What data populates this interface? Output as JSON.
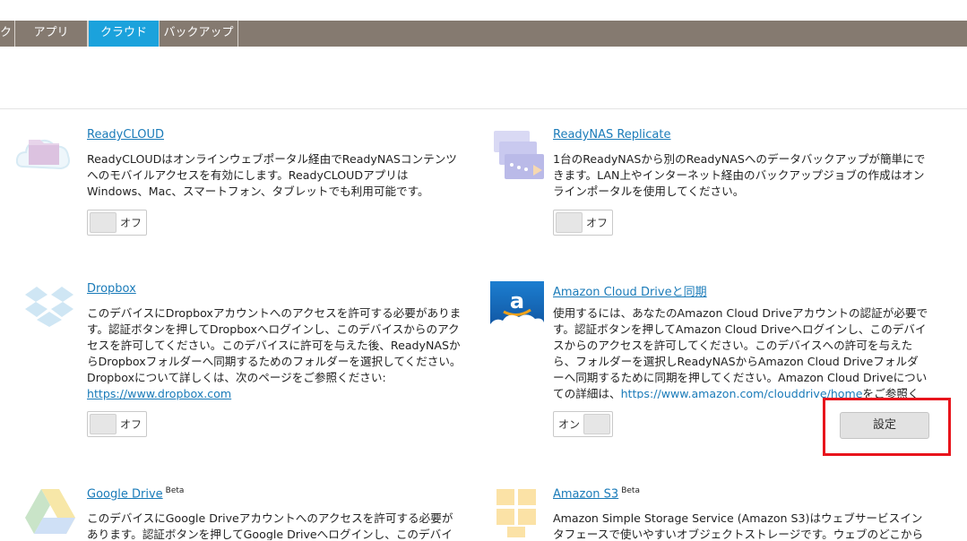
{
  "tabs": [
    {
      "label": "ク"
    },
    {
      "label": "アプリ"
    },
    {
      "label": "クラウド"
    },
    {
      "label": "バックアップ"
    }
  ],
  "colors": {
    "tabbar": "#857a70",
    "active_tab": "#1ba2dc",
    "link": "#1a7bb9",
    "highlight": "#e8141c"
  },
  "apps": [
    {
      "title": "ReadyCLOUD",
      "icon": "readycloud-icon",
      "desc": "ReadyCLOUDはオンラインウェブポータル経由でReadyNASコンテンツへのモバイルアクセスを有効にします。ReadyCLOUDアプリはWindows、Mac、スマートフォン、タブレットでも利用可能です。",
      "toggle": "オフ"
    },
    {
      "title": "ReadyNAS Replicate",
      "icon": "replicate-icon",
      "desc": "1台のReadyNASから別のReadyNASへのデータバックアップが簡単にできます。LAN上やインターネット経由のバックアップジョブの作成はオンラインポータルを使用してください。",
      "toggle": "オフ"
    },
    {
      "title": "Dropbox",
      "icon": "dropbox-icon",
      "desc": "このデバイスにDropboxアカウントへのアクセスを許可する必要があります。認証ボタンを押してDropboxへログインし、このデバイスからのアクセスを許可してください。このデバイスに許可を与えた後、ReadyNASからDropboxフォルダーへ同期するためのフォルダーを選択してください。Dropboxについて詳しくは、次のページをご参照ください:",
      "link": "https://www.dropbox.com",
      "toggle": "オフ"
    },
    {
      "title": "Amazon Cloud Driveと同期",
      "icon": "amazon-cloud-drive-icon",
      "desc": "使用するには、あなたのAmazon Cloud Driveアカウントの認証が必要です。認証ボタンを押してAmazon Cloud Driveへログインし、このデバイスからのアクセスを許可してください。このデバイスへの許可を与えたら、フォルダーを選択しReadyNASからAmazon Cloud Driveフォルダーへ同期するために同期を押してください。Amazon Cloud Driveについての詳細は、",
      "link": "https://www.amazon.com/clouddrive/home",
      "desc_tail": "をご参照ください。",
      "toggle": "オン",
      "settings": "設定"
    },
    {
      "title": "Google Drive",
      "beta": "Beta",
      "icon": "google-drive-icon",
      "desc": "このデバイスにGoogle Driveアカウントへのアクセスを許可する必要があります。認証ボタンを押してGoogle Driveへログインし、このデバイス"
    },
    {
      "title": "Amazon S3",
      "beta": "Beta",
      "icon": "amazon-s3-icon",
      "desc": "Amazon Simple Storage Service (Amazon S3)はウェブサービスインタフェースで使いやすいオブジェクトストレージです。ウェブのどこからでも"
    }
  ]
}
